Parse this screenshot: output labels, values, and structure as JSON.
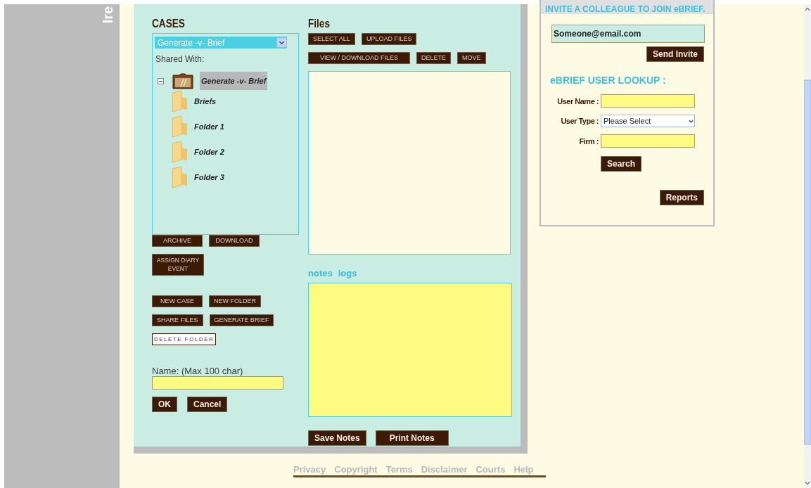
{
  "side_label": "Ire",
  "cases": {
    "title": "CASES",
    "case_select": "Generate -v- Brief",
    "shared_with": "Shared With:",
    "tree": {
      "label": "Generate -v- Brief",
      "expanded": true,
      "selected": true,
      "children": [
        {
          "label": "Briefs",
          "selected": false
        },
        {
          "label": "Folder 1",
          "selected": false
        },
        {
          "label": "Folder 2",
          "selected": false
        },
        {
          "label": "Folder 3",
          "selected": false
        }
      ]
    },
    "button_rows": [
      [
        "ARCHIVE",
        "DOWNLOAD"
      ],
      [
        "ASSIGN DIARY EVENT"
      ],
      [
        "NEW CASE",
        "NEW FOLDER"
      ],
      [
        "SHARE FILES",
        "GENERATE BRIEF"
      ]
    ],
    "delete_button": "DELETE FOLDER",
    "name_label": "Name: (Max 100 char)",
    "actions": [
      "OK",
      "Cancel"
    ]
  },
  "files": {
    "title": "Files",
    "button_rows": [
      [
        "SELECT ALL",
        "UPLOAD FILES"
      ],
      [
        "VIEW / DOWNLOAD FILES",
        "DELETE",
        "MOVE"
      ]
    ],
    "tabs": [
      {
        "label": "notes",
        "selected": false
      },
      {
        "label": "logs",
        "selected": false
      }
    ],
    "note_buttons": [
      "Save Notes",
      "Print Notes"
    ]
  },
  "invite": {
    "title": "INVITE A COLLEAGUE TO JOIN eBRIEF.",
    "email": "Someone@email.com",
    "send": "Send Invite"
  },
  "lookup": {
    "title": "eBRIEF USER LOOKUP :",
    "fields": [
      {
        "kind": "text",
        "label": "User Name :"
      },
      {
        "kind": "select",
        "label": "User Type :",
        "value": "Please Select"
      },
      {
        "kind": "text",
        "label": "Firm :"
      }
    ],
    "search": "Search",
    "reports": "Reports"
  },
  "footer": [
    "Privacy",
    "Copyright",
    "Terms",
    "Disclaimer",
    "Courts",
    "Help"
  ]
}
